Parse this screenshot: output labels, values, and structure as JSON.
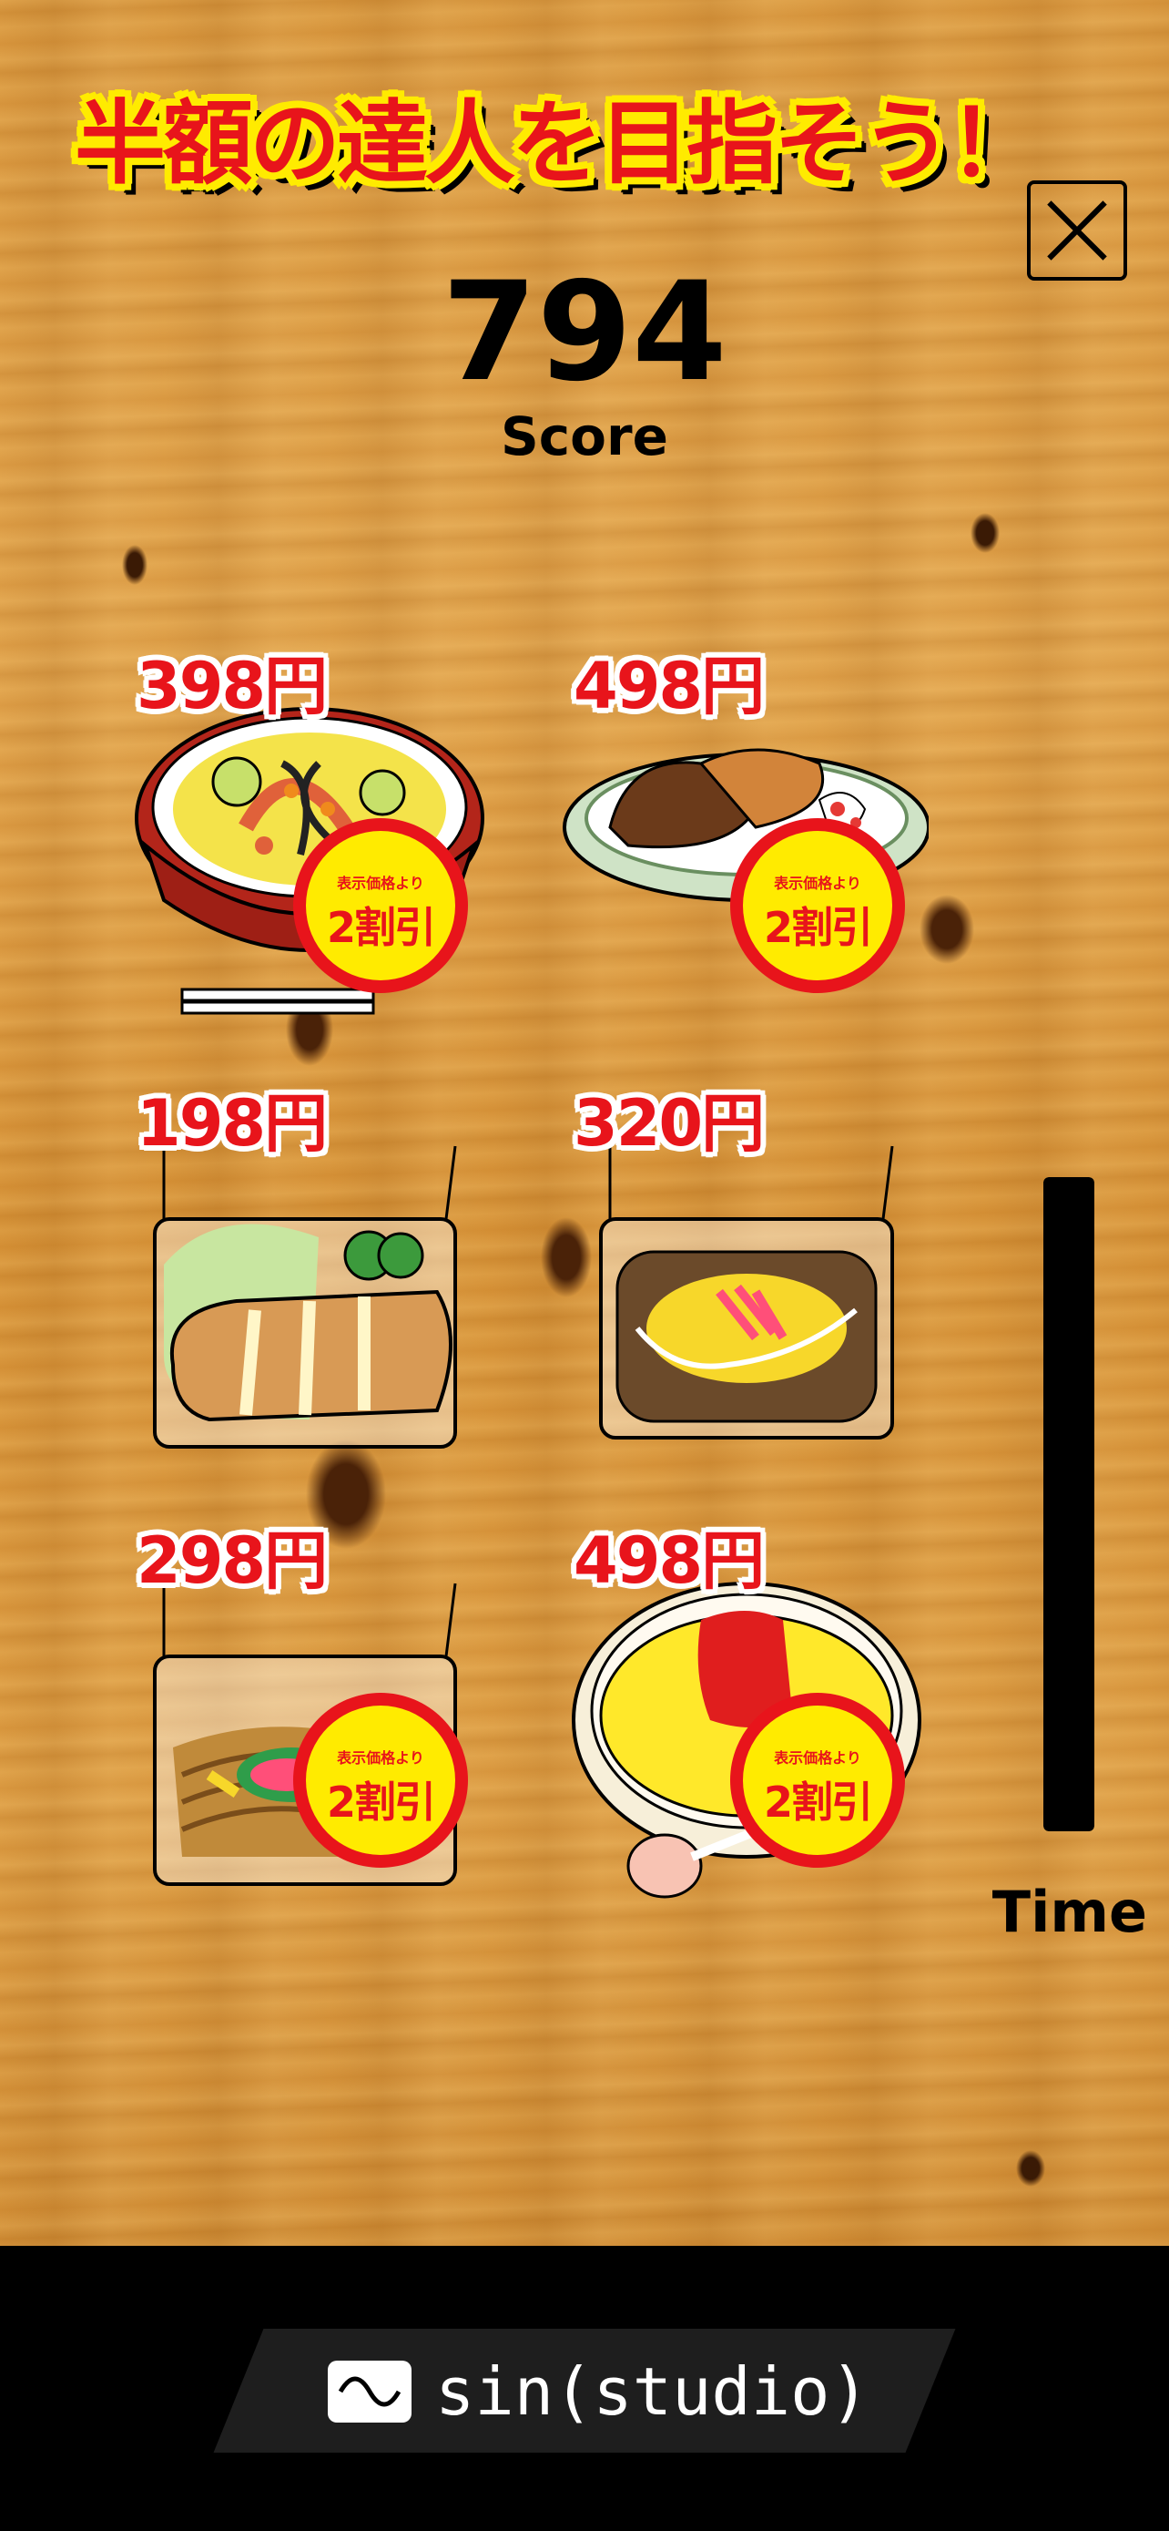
{
  "title": "半額の達人を目指そう！",
  "close_icon": "close-icon",
  "score": {
    "value": "794",
    "label": "Score"
  },
  "badge": {
    "small": "表示価格より",
    "big": "2割引"
  },
  "items": [
    {
      "price": "398円",
      "food": "ramen-bowl",
      "discount": true
    },
    {
      "price": "498円",
      "food": "curry-plate",
      "discount": true
    },
    {
      "price": "198円",
      "food": "tonkatsu-box",
      "discount": false
    },
    {
      "price": "320円",
      "food": "okonomiyaki-box",
      "discount": false
    },
    {
      "price": "298円",
      "food": "yakisoba-box",
      "discount": true
    },
    {
      "price": "498円",
      "food": "omurice-plate",
      "discount": true
    }
  ],
  "time": {
    "label": "Time",
    "remaining_fraction": 1.0
  },
  "footer": {
    "brand": "sin(studio)",
    "logo_icon": "sine-wave-icon"
  },
  "colors": {
    "price_red": "#e8141b",
    "title_yellow": "#ffeb00",
    "wood": "#dc9c42"
  }
}
